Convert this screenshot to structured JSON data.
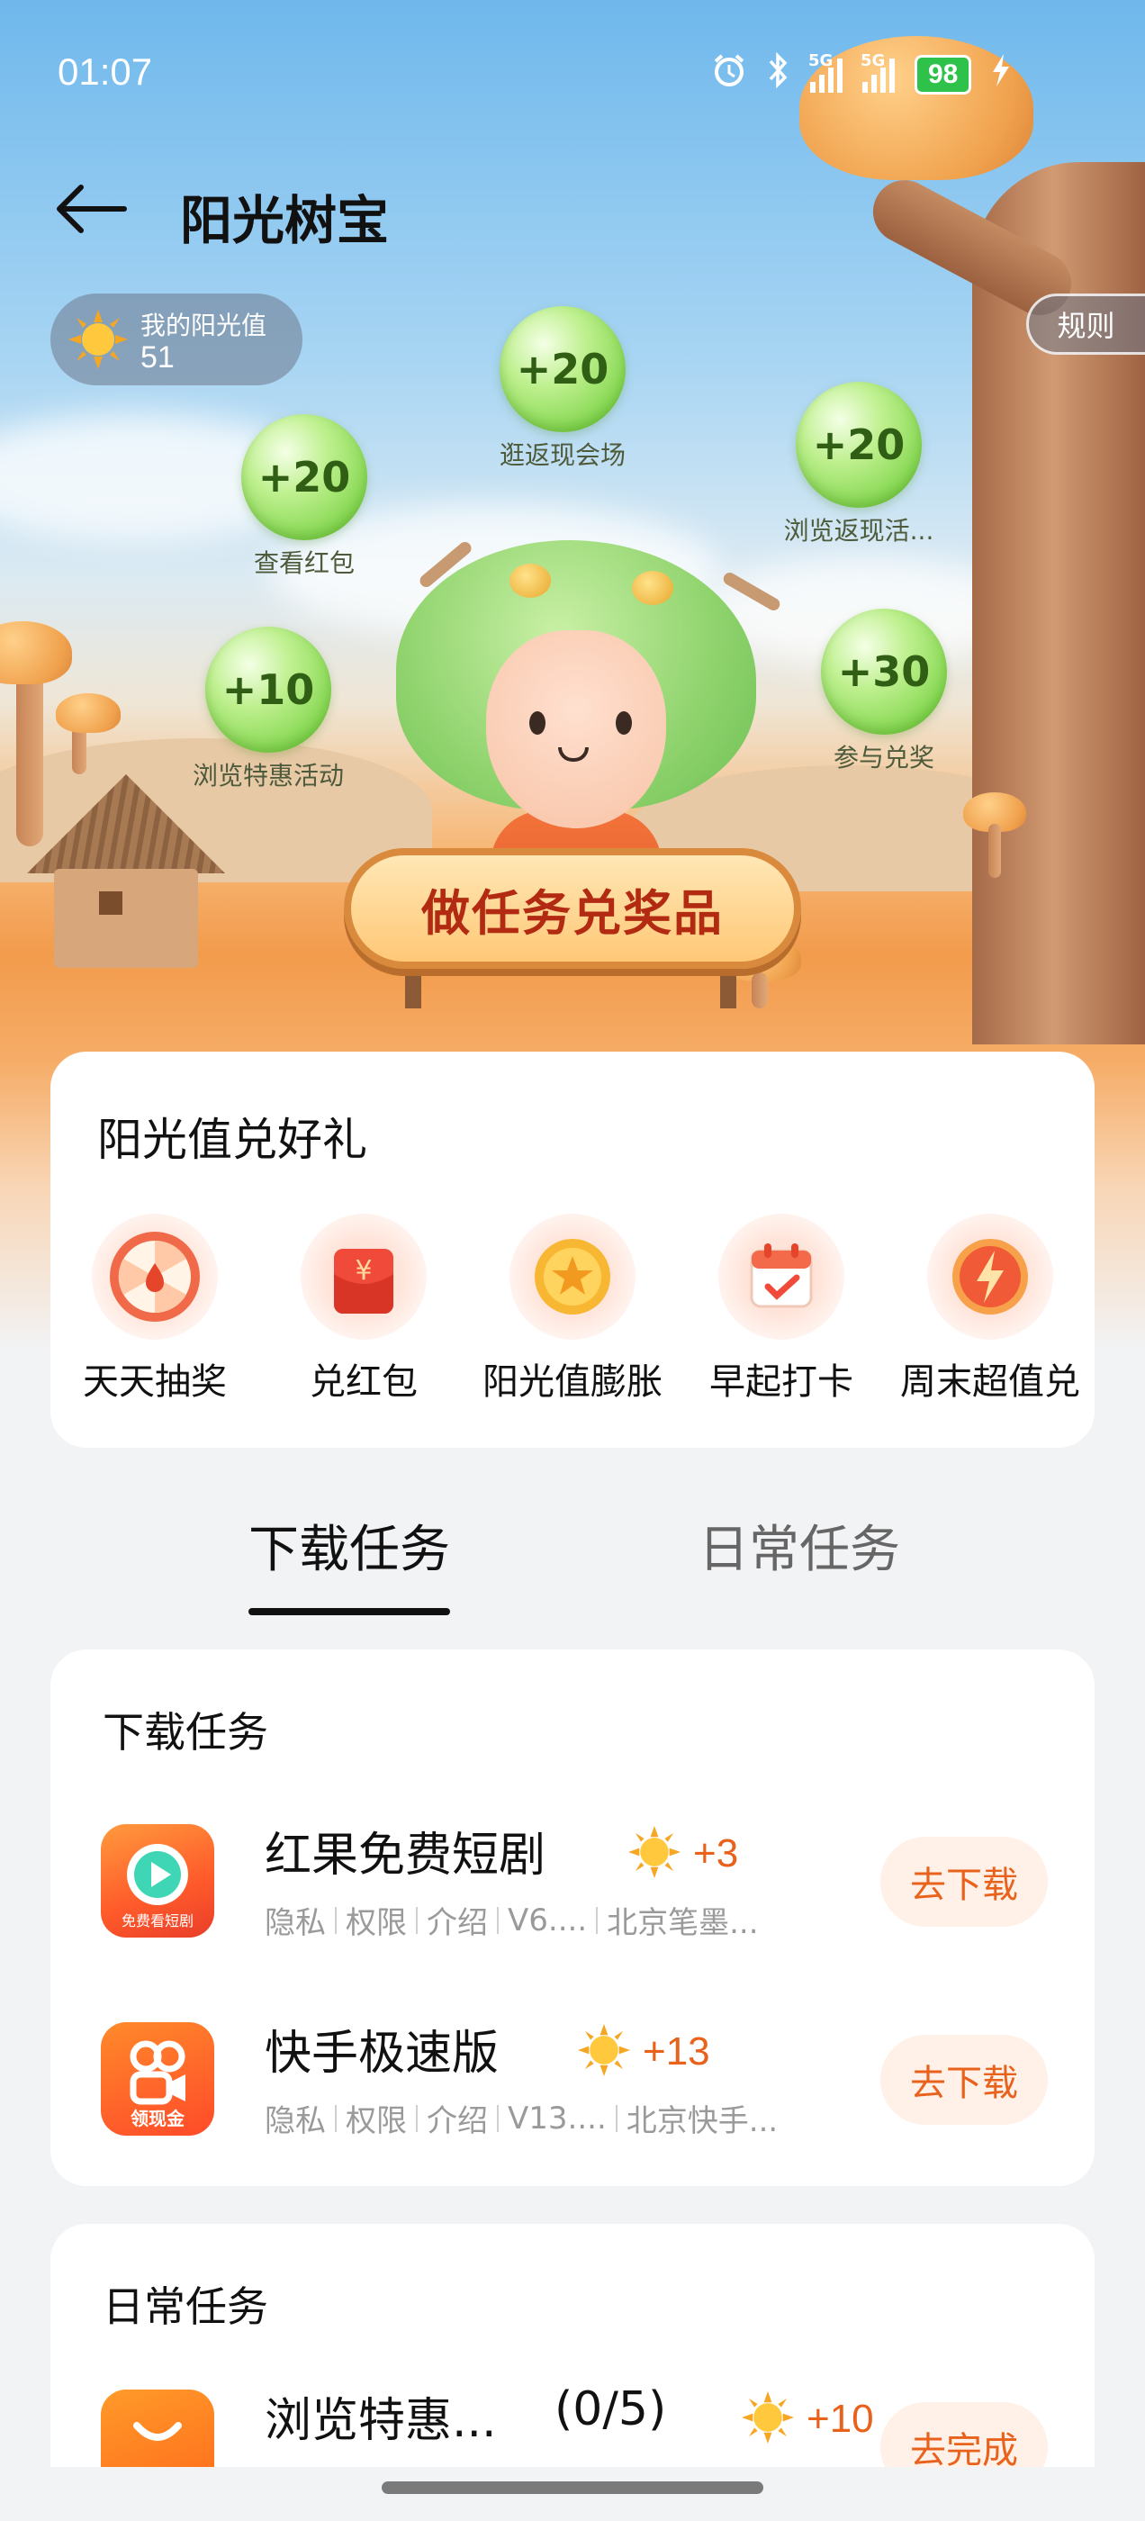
{
  "status_bar": {
    "time": "01:07",
    "battery": "98",
    "sig1": "5G",
    "sig2": "5G"
  },
  "header": {
    "title": "阳光树宝"
  },
  "sunshine": {
    "label": "我的阳光值",
    "value": "51"
  },
  "rules_label": "规则",
  "bubbles": [
    {
      "points": "+20",
      "label": "逛返现会场"
    },
    {
      "points": "+20",
      "label": "查看红包"
    },
    {
      "points": "+20",
      "label": "浏览返现活..."
    },
    {
      "points": "+10",
      "label": "浏览特惠活动"
    },
    {
      "points": "+30",
      "label": "参与兑奖"
    }
  ],
  "sign_text": "做任务兑奖品",
  "rewards": {
    "title": "阳光值兑好礼",
    "items": [
      {
        "label": "天天抽奖",
        "icon": "wheel-icon"
      },
      {
        "label": "兑红包",
        "icon": "red-envelope-icon"
      },
      {
        "label": "阳光值膨胀",
        "icon": "star-coin-icon"
      },
      {
        "label": "早起打卡",
        "icon": "calendar-icon"
      },
      {
        "label": "周末超值兑",
        "icon": "lightning-coupon-icon"
      }
    ]
  },
  "tabs": [
    {
      "label": "下载任务",
      "active": true
    },
    {
      "label": "日常任务",
      "active": false
    }
  ],
  "download_section": {
    "title": "下载任务",
    "apps": [
      {
        "name": "红果免费短剧",
        "points": "+3",
        "meta": [
          "隐私",
          "权限",
          "介绍",
          "V6....",
          "北京笔墨..."
        ],
        "button": "去下载",
        "icon_text": "免费看短剧"
      },
      {
        "name": "快手极速版",
        "points": "+13",
        "meta": [
          "隐私",
          "权限",
          "介绍",
          "V13....",
          "北京快手..."
        ],
        "button": "去下载",
        "icon_text": "领现金"
      }
    ]
  },
  "daily_section": {
    "title": "日常任务",
    "task": {
      "name": "浏览特惠...",
      "progress": "(0/5)",
      "points": "+10",
      "button": "去完成"
    }
  }
}
